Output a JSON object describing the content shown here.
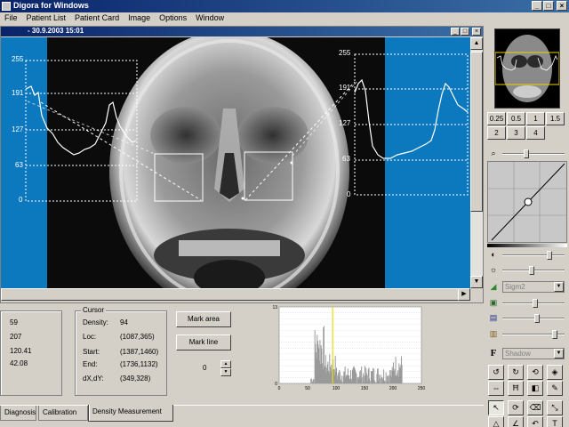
{
  "window": {
    "title": "Digora for Windows"
  },
  "menu": [
    "File",
    "Patient List",
    "Patient Card",
    "Image",
    "Options",
    "Window"
  ],
  "image_window": {
    "title": "- 30.9.2003 15:01"
  },
  "profile_axis": {
    "ticks": [
      "255",
      "191",
      "127",
      "63",
      "0"
    ]
  },
  "values": [
    "59",
    "207",
    "120.41",
    "42.08"
  ],
  "cursor": {
    "legend": "Cursor",
    "rows": [
      {
        "label": "Density:",
        "value": "94"
      },
      {
        "label": "Loc:",
        "value": "(1087,365)"
      },
      {
        "label": "Start:",
        "value": "(1387,1460)"
      },
      {
        "label": "End:",
        "value": "(1736,1132)"
      },
      {
        "label": "dX,dY:",
        "value": "(349,328)"
      }
    ]
  },
  "buttons": {
    "mark_area": "Mark area",
    "mark_line": "Mark line"
  },
  "spinner": {
    "value": "0"
  },
  "histogram": {
    "chart_data": {
      "type": "bar",
      "ylim": [
        0,
        13
      ],
      "xlim": [
        0,
        250
      ],
      "yticks": [
        "13",
        "12",
        "11",
        "10",
        "9",
        "8",
        "7",
        "6",
        "5",
        "4",
        "3",
        "2",
        "1",
        "0"
      ],
      "xticks": [
        "0",
        "50",
        "100",
        "150",
        "200",
        "250"
      ],
      "marker_x": 94
    }
  },
  "tabs": [
    "Diagnosis",
    "Calibration",
    "Density Measurement"
  ],
  "zoom": {
    "row1": [
      "0.25",
      "0.5",
      "1",
      "1.5"
    ],
    "row2": [
      "2",
      "3",
      "4"
    ]
  },
  "tools": {
    "filter_combo": "Sigm2",
    "shadow_combo": "Shadow",
    "font_icon": "F"
  },
  "icons": {
    "magnifier": "magnifier-icon",
    "contrast": "contrast-icon",
    "brightness": "brightness-icon"
  }
}
